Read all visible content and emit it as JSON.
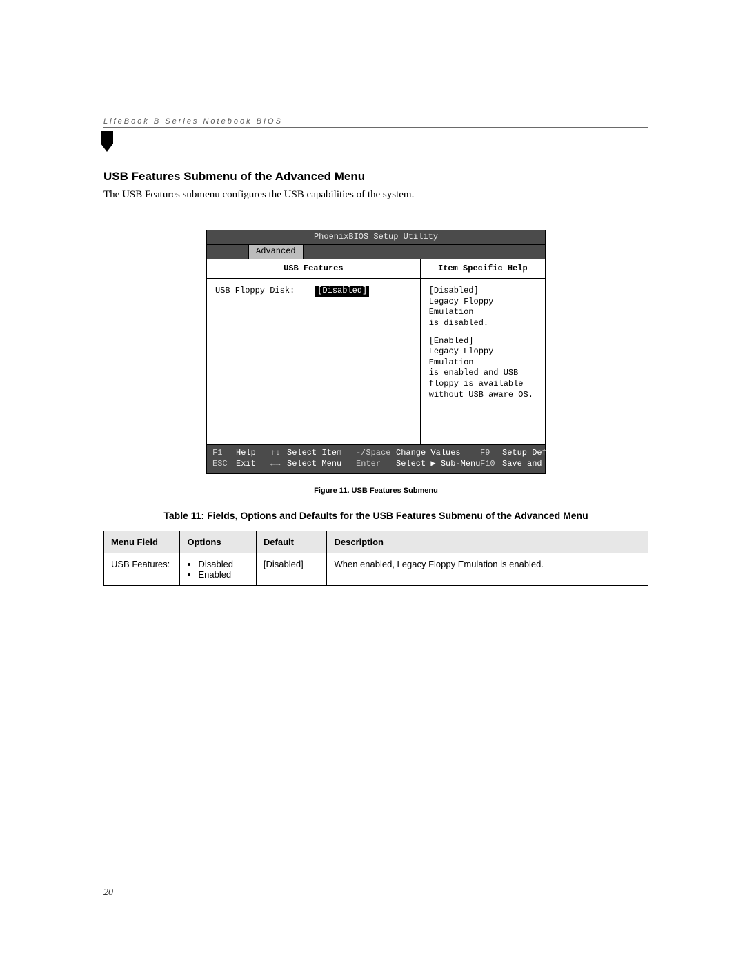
{
  "running_header": "LifeBook B Series Notebook BIOS",
  "section_title": "USB Features Submenu of the Advanced Menu",
  "section_intro": "The USB Features submenu configures the USB capabilities of the system.",
  "bios": {
    "titlebar": "PhoenixBIOS Setup Utility",
    "active_tab": "Advanced",
    "left_header": "USB Features",
    "right_header": "Item Specific Help",
    "field_label": "USB Floppy Disk:",
    "field_value": "[Disabled]",
    "help_p1_line1": "[Disabled]",
    "help_p1_line2": "Legacy Floppy Emulation",
    "help_p1_line3": "is disabled.",
    "help_p2_line1": "[Enabled]",
    "help_p2_line2": "Legacy Floppy Emulation",
    "help_p2_line3": "is enabled and USB",
    "help_p2_line4": "floppy is available",
    "help_p2_line5": "without USB aware OS.",
    "footer": {
      "r1_k1": "F1",
      "r1_v1": "Help",
      "r1_k2": "↑↓",
      "r1_v2": "Select Item",
      "r1_k3": "-/Space",
      "r1_v3": "Change Values",
      "r1_k4": "F9",
      "r1_v4": "Setup Defaults",
      "r2_k1": "ESC",
      "r2_v1": "Exit",
      "r2_k2": "←→",
      "r2_v2": "Select Menu",
      "r2_k3": "Enter",
      "r2_v3": "Select ▶ Sub-Menu",
      "r2_k4": "F10",
      "r2_v4": "Save and Exit"
    }
  },
  "figure_caption": "Figure 11.  USB Features Submenu",
  "table_caption": "Table 11: Fields, Options and Defaults for the USB Features Submenu of the Advanced Menu",
  "table": {
    "headers": {
      "menu_field": "Menu Field",
      "options": "Options",
      "default_": "Default",
      "description": "Description"
    },
    "row": {
      "menu_field": "USB Features:",
      "option1": "Disabled",
      "option2": "Enabled",
      "default_": "[Disabled]",
      "description": "When enabled, Legacy Floppy Emulation is enabled."
    }
  },
  "page_number": "20",
  "col_widths": {
    "c1": "14%",
    "c2": "14%",
    "c3": "13%",
    "c4": "59%"
  }
}
